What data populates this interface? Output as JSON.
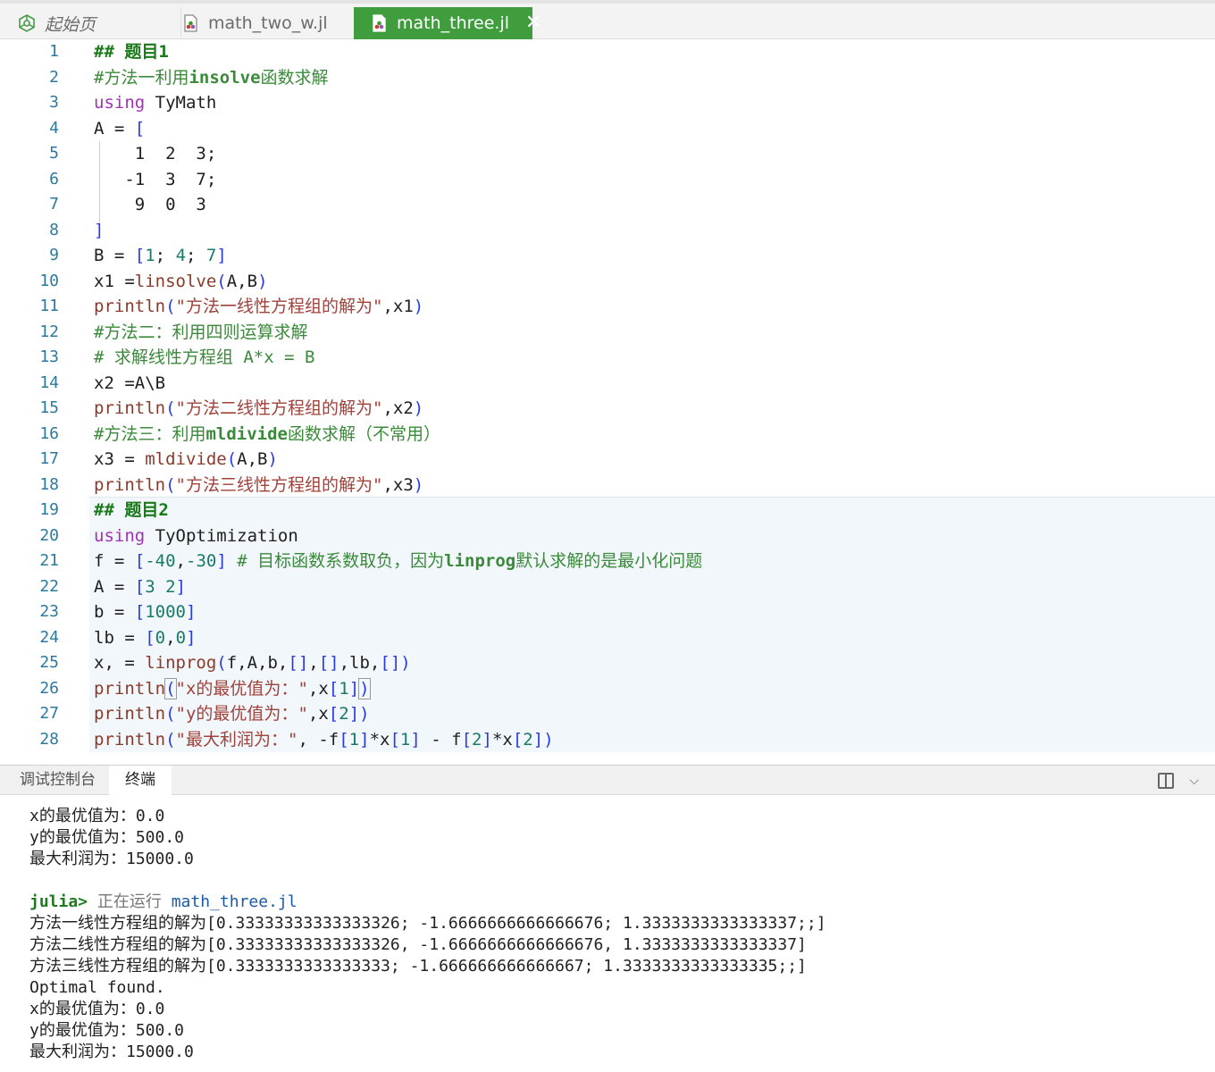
{
  "tabs": {
    "start": "起始页",
    "two": "math_two_w.jl",
    "three": "math_three.jl",
    "close": "✕"
  },
  "colors": {
    "active_tab": "#3f9d3e",
    "prompt": "#1f7a1f"
  },
  "editor": {
    "lines": [
      {
        "n": "1",
        "html": "<span class=\"cb\">## 题目1</span>"
      },
      {
        "n": "2",
        "html": "<span class=\"c\">#<span class=\"rm\">方法一利用</span><b>insolve</b><span class=\"rm\">函数求解</span></span>"
      },
      {
        "n": "3",
        "html": "<span class=\"kw\">using</span> TyMath"
      },
      {
        "n": "4",
        "html": "A = <span class=\"br\">[</span>"
      },
      {
        "n": "5",
        "html": "    1  2  3;"
      },
      {
        "n": "6",
        "html": "   -1  3  7;"
      },
      {
        "n": "7",
        "html": "    9  0  3"
      },
      {
        "n": "8",
        "html": "<span class=\"br\">]</span>"
      },
      {
        "n": "9",
        "html": "B = <span class=\"br\">[</span><span class=\"num\">1</span>; <span class=\"num\">4</span>; <span class=\"num\">7</span><span class=\"br\">]</span>"
      },
      {
        "n": "10",
        "html": "x1 =<span class=\"fn\">linsolve</span><span class=\"br\">(</span>A,B<span class=\"br\">)</span>"
      },
      {
        "n": "11",
        "html": "<span class=\"fn\">println</span><span class=\"br\">(</span><span class=\"str\">\"<span class=\"rm\">方法一线性方程组的解为</span>\"</span>,x1<span class=\"br\">)</span>"
      },
      {
        "n": "12",
        "html": "<span class=\"c\">#<span class=\"rm\">方法二：利用四则运算求解</span></span>"
      },
      {
        "n": "13",
        "html": "<span class=\"c\"># <span class=\"rm\">求解线性方程组</span> A*x = B</span>"
      },
      {
        "n": "14",
        "html": "x2 =A\\B"
      },
      {
        "n": "15",
        "html": "<span class=\"fn\">println</span><span class=\"br\">(</span><span class=\"str\">\"<span class=\"rm\">方法二线性方程组的解为</span>\"</span>,x2<span class=\"br\">)</span>"
      },
      {
        "n": "16",
        "html": "<span class=\"c\">#<span class=\"rm\">方法三：利用</span><b>mldivide</b><span class=\"rm\">函数求解（不常用）</span></span>"
      },
      {
        "n": "17",
        "html": "x3 = <span class=\"fn\">mldivide</span><span class=\"br\">(</span>A,B<span class=\"br\">)</span>"
      },
      {
        "n": "18",
        "html": "<span class=\"fn\">println</span><span class=\"br\">(</span><span class=\"str\">\"<span class=\"rm\">方法三线性方程组的解为</span>\"</span>,x3<span class=\"br\">)</span>"
      },
      {
        "n": "19",
        "html": "<span class=\"cb\">## 题目2</span>"
      },
      {
        "n": "20",
        "html": "<span class=\"kw\">using</span> TyOptimization"
      },
      {
        "n": "21",
        "html": "f = <span class=\"br\">[</span><span class=\"num\">-40</span>,<span class=\"num\">-30</span><span class=\"br\">]</span> <span class=\"c\"># <span class=\"rm\">目标函数系数取负，因为</span><b>linprog</b><span class=\"rm\">默认求解的是最小化问题</span></span>"
      },
      {
        "n": "22",
        "html": "A = <span class=\"br\">[</span><span class=\"num\">3</span> <span class=\"num\">2</span><span class=\"br\">]</span>"
      },
      {
        "n": "23",
        "html": "b = <span class=\"br\">[</span><span class=\"num\">1000</span><span class=\"br\">]</span>"
      },
      {
        "n": "24",
        "html": "lb = <span class=\"br\">[</span><span class=\"num\">0</span>,<span class=\"num\">0</span><span class=\"br\">]</span>"
      },
      {
        "n": "25",
        "html": "x, = <span class=\"fn\">linprog</span><span class=\"br\">(</span>f,A,b,<span class=\"br\">[]</span>,<span class=\"br\">[]</span>,lb,<span class=\"br\">[]</span><span class=\"br\">)</span>"
      },
      {
        "n": "26",
        "html": "<span class=\"fn\">println</span><span class=\"br\" style=\"outline:1px solid #999\">(</span><span class=\"str\">\"x<span class=\"rm\">的最优值为：</span>\"</span>,x<span class=\"br\">[</span><span class=\"num\">1</span><span class=\"br\">]</span><span class=\"br\" style=\"outline:1px solid #999\">)</span>"
      },
      {
        "n": "27",
        "html": "<span class=\"fn\">println</span><span class=\"br\">(</span><span class=\"str\">\"y<span class=\"rm\">的最优值为：</span>\"</span>,x<span class=\"br\">[</span><span class=\"num\">2</span><span class=\"br\">]</span><span class=\"br\">)</span>"
      },
      {
        "n": "28",
        "html": "<span class=\"fn\">println</span><span class=\"br\">(</span><span class=\"str\">\"<span class=\"rm\">最大利润为：</span>\"</span>, -f<span class=\"br\">[</span><span class=\"num\">1</span><span class=\"br\">]</span>*x<span class=\"br\">[</span><span class=\"num\">1</span><span class=\"br\">]</span> - f<span class=\"br\">[</span><span class=\"num\">2</span><span class=\"br\">]</span>*x<span class=\"br\">[</span><span class=\"num\">2</span><span class=\"br\">]</span><span class=\"br\">)</span>"
      }
    ]
  },
  "panel": {
    "tab_debug": "调试控制台",
    "tab_terminal": "终端",
    "split_chevron": "⌵"
  },
  "terminal": {
    "lines": [
      "x的最优值为：0.0",
      "y的最优值为：500.0",
      "最大利润为：15000.0",
      "",
      "",
      "方法一线性方程组的解为[0.33333333333333326; -1.6666666666666676; 1.3333333333333337;;]",
      "方法二线性方程组的解为[0.33333333333333326, -1.6666666666666676, 1.3333333333333337]",
      "方法三线性方程组的解为[0.3333333333333333; -1.666666666666667; 1.3333333333333335;;]",
      "Optimal found.",
      "x的最优值为：0.0",
      "y的最优值为：500.0",
      "最大利润为：15000.0"
    ],
    "prompt": "julia>",
    "running_text": "正在运行",
    "running_file": "math_three.jl"
  }
}
